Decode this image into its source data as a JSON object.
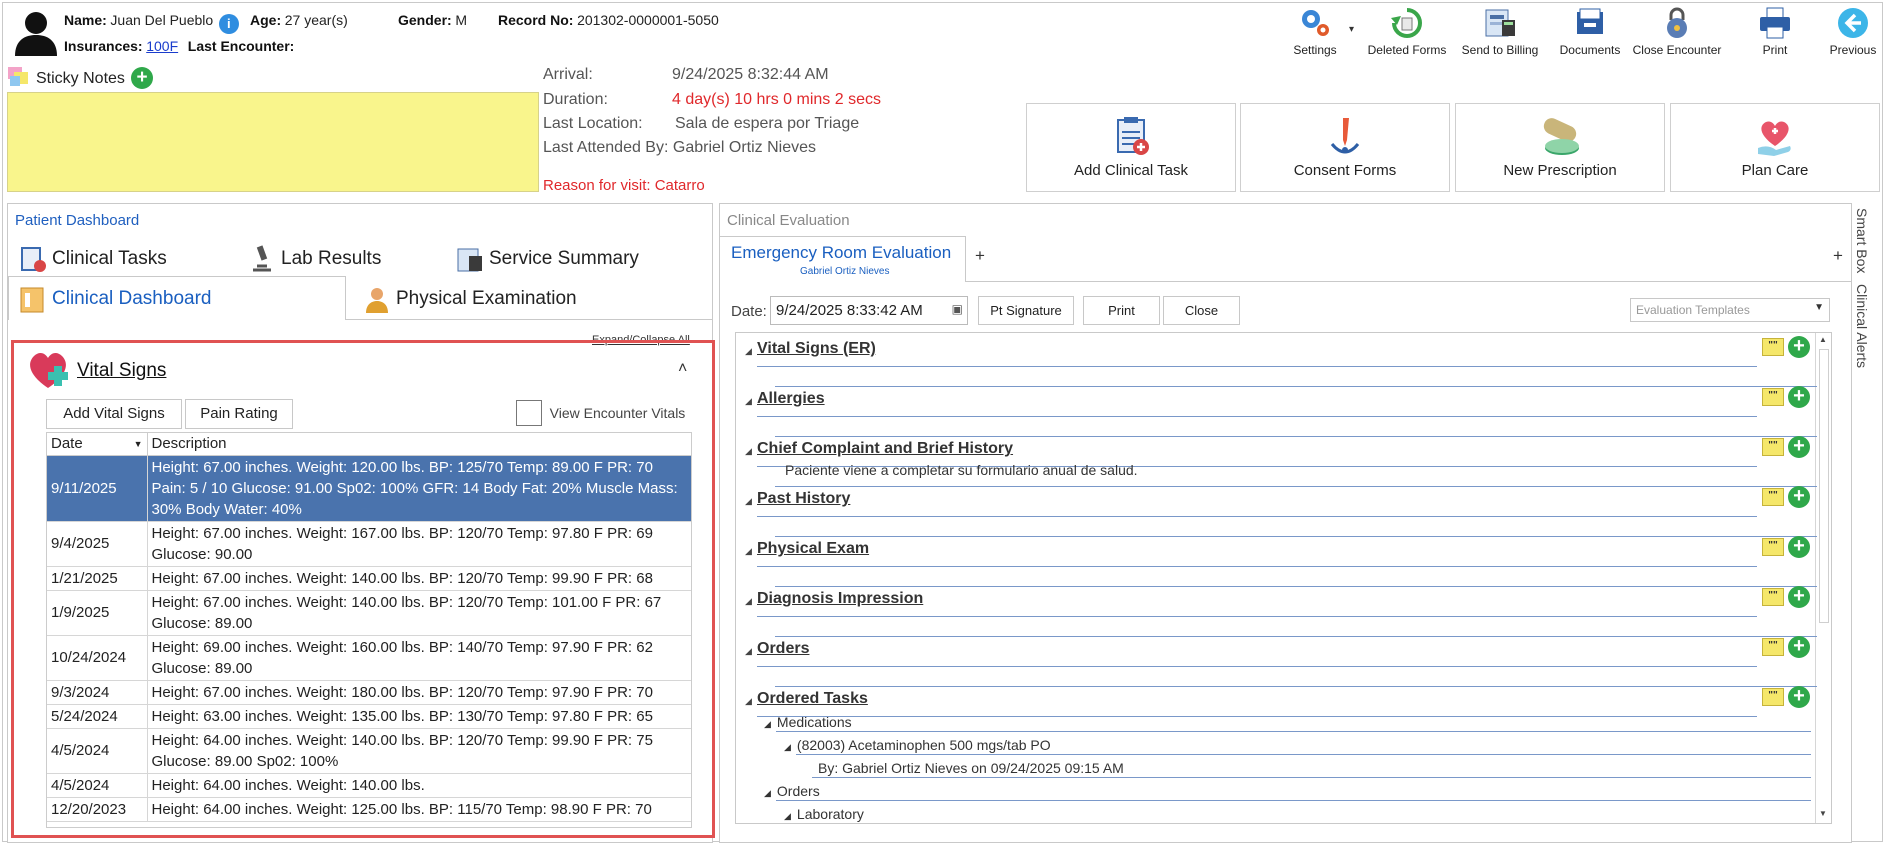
{
  "patient": {
    "name_label": "Name:",
    "name_value": "Juan Del Pueblo",
    "info_glyph": "i",
    "age_label": "Age:",
    "age_value": "27 year(s)",
    "gender_label": "Gender:",
    "gender_value": "M",
    "record_label": "Record No:",
    "record_value": "201302-0000001-5050",
    "insurances_label": "Insurances:",
    "insurances_value": "100F",
    "last_encounter_label": "Last Encounter:",
    "last_encounter_value": ""
  },
  "toolbar": {
    "settings": "Settings",
    "deleted_forms": "Deleted Forms",
    "send_to_billing": "Send to Billing",
    "documents": "Documents",
    "close_encounter": "Close Encounter",
    "print": "Print",
    "previous": "Previous"
  },
  "sticky": {
    "label": "Sticky Notes",
    "add_glyph": "+"
  },
  "encounter": {
    "arrival_label": "Arrival:",
    "arrival_value": "9/24/2025 8:32:44 AM",
    "duration_label": "Duration:",
    "duration_value": "4 day(s) 10 hrs 0 mins 2 secs",
    "last_location_label": "Last Location:",
    "last_location_value": "Sala de espera por Triage",
    "last_attended": "Last Attended By: Gabriel Ortiz Nieves",
    "reason": "Reason for visit: Catarro"
  },
  "actions": {
    "add_clinical_task": "Add Clinical Task",
    "consent_forms": "Consent Forms",
    "new_prescription": "New Prescription",
    "plan_care": "Plan Care"
  },
  "dashboard": {
    "title": "Patient Dashboard",
    "tabs": [
      "Clinical Tasks",
      "Lab Results",
      "Service Summary",
      "Clinical Dashboard",
      "Physical Examination"
    ],
    "expand_collapse": "Expand/Collapse All",
    "vitals_title": "Vital Signs",
    "collapse_glyph": "˄",
    "add_vital_signs": "Add Vital Signs",
    "pain_rating": "Pain Rating",
    "view_encounter_vitals": "View Encounter Vitals",
    "col_date": "Date",
    "col_desc": "Description",
    "rows": [
      {
        "date": "9/11/2025",
        "desc": "Height: 67.00 inches. Weight: 120.00 lbs. BP: 125/70 Temp: 89.00 F PR: 70 Pain: 5 / 10 Glucose: 91.00 Sp02: 100% GFR: 14 Body Fat: 20% Muscle Mass: 30% Body Water: 40%"
      },
      {
        "date": "9/4/2025",
        "desc": "Height: 67.00 inches. Weight: 167.00 lbs. BP: 120/70 Temp: 97.80 F PR: 69 Glucose: 90.00"
      },
      {
        "date": "1/21/2025",
        "desc": "Height: 67.00 inches. Weight: 140.00 lbs. BP: 120/70 Temp: 99.90 F PR: 68"
      },
      {
        "date": "1/9/2025",
        "desc": "Height: 67.00 inches. Weight: 140.00 lbs. BP: 120/70 Temp: 101.00 F PR: 67 Glucose: 89.00"
      },
      {
        "date": "10/24/2024",
        "desc": "Height: 69.00 inches. Weight: 160.00 lbs. BP: 140/70 Temp: 97.90 F PR: 62 Glucose: 89.00"
      },
      {
        "date": "9/3/2024",
        "desc": "Height: 67.00 inches. Weight: 180.00 lbs. BP: 120/70 Temp: 97.90 F PR: 70"
      },
      {
        "date": "5/24/2024",
        "desc": "Height: 63.00 inches. Weight: 135.00 lbs. BP: 130/70 Temp: 97.80 F PR: 65"
      },
      {
        "date": "4/5/2024",
        "desc": "Height: 64.00 inches. Weight: 140.00 lbs. BP: 120/70 Temp: 99.90 F PR: 75 Glucose: 89.00 Sp02: 100%"
      },
      {
        "date": "4/5/2024",
        "desc": "Height: 64.00 inches. Weight: 140.00 lbs."
      },
      {
        "date": "12/20/2023",
        "desc": "Height: 64.00 inches. Weight: 125.00 lbs. BP: 115/70 Temp: 98.90 F PR: 70"
      }
    ]
  },
  "evaluation": {
    "pane_title": "Clinical Evaluation",
    "tab_title": "Emergency Room Evaluation",
    "tab_subtitle": "Gabriel Ortiz Nieves",
    "add_tab_glyph": "+",
    "date_label": "Date:",
    "date_value": "9/24/2025 8:33:42 AM",
    "pt_signature": "Pt Signature",
    "print": "Print",
    "close": "Close",
    "templates_placeholder": "Evaluation Templates",
    "sections": [
      {
        "title": "Vital Signs (ER)",
        "content": ""
      },
      {
        "title": "Allergies",
        "content": ""
      },
      {
        "title": "Chief Complaint and Brief History",
        "content": "Paciente viene a completar su formulario anual de salud."
      },
      {
        "title": "Past History",
        "content": ""
      },
      {
        "title": "Physical Exam",
        "content": ""
      },
      {
        "title": "Diagnosis Impression",
        "content": ""
      },
      {
        "title": "Orders",
        "content": ""
      },
      {
        "title": "Ordered Tasks",
        "content": ""
      }
    ],
    "ordered": {
      "medications": "Medications",
      "med_item": "(82003) Acetaminophen 500 mgs/tab PO",
      "med_by": "By: Gabriel Ortiz Nieves on 09/24/2025 09:15 AM",
      "orders": "Orders",
      "laboratory": "Laboratory"
    },
    "note_glyph": "\"\"",
    "add_glyph": "+"
  },
  "side": {
    "smart_box": "Smart Box",
    "clinical_alerts": "Clinical Alerts"
  }
}
